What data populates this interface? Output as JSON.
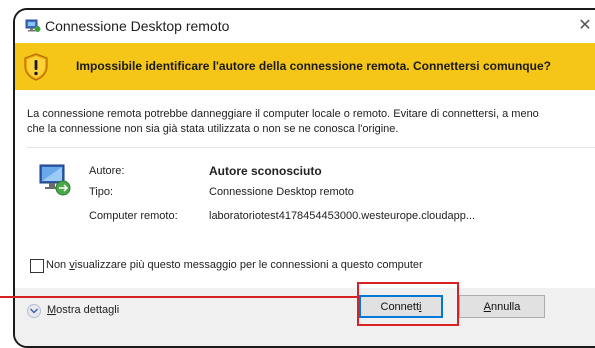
{
  "window": {
    "title": "Connessione Desktop remoto",
    "close_glyph": "✕",
    "warning": "Impossibile identificare l'autore della connessione remota. Connettersi comunque?",
    "description": "La connessione remota potrebbe danneggiare il computer locale o remoto. Evitare di connettersi, a meno che la connessione non sia già stata utilizzata o non se ne conosca l'origine."
  },
  "fields": [
    {
      "label": "Autore:",
      "value": "Autore sconosciuto"
    },
    {
      "label": "Tipo:",
      "value": "Connessione Desktop remoto"
    },
    {
      "label": "Computer remoto:",
      "value": "laboratoriotest4178454453000.westeurope.cloudapp..."
    }
  ],
  "checkbox": {
    "pre": "Non ",
    "accel": "v",
    "post": "isualizzare più questo messaggio per le connessioni a questo computer",
    "checked": false
  },
  "footer": {
    "details_accel": "M",
    "details_rest": "ostra dettagli",
    "connect_pre": "Connett",
    "connect_accel": "i",
    "cancel_accel": "A",
    "cancel_rest": "nnulla"
  },
  "colors": {
    "warning_bar": "#f5c518",
    "highlight": "#d62222",
    "focus_border": "#0078d7"
  },
  "icons": [
    "remote-desktop-icon",
    "warning-shield-icon",
    "close-icon",
    "computer-network-icon",
    "expand-chevron-icon"
  ]
}
